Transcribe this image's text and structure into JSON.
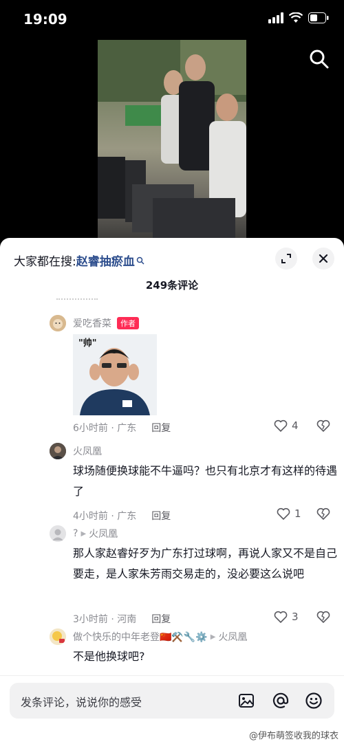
{
  "status": {
    "time": "19:09"
  },
  "icons": {
    "search": "search-icon",
    "signal": "signal-icon",
    "wifi": "wifi-icon",
    "battery": "battery-icon",
    "expand": "expand-icon",
    "close": "close-icon",
    "image": "image-icon",
    "mention": "at-icon",
    "emoji": "emoji-icon"
  },
  "header": {
    "hot_search_prefix": "大家都在搜:",
    "hot_search_term": "赵睿抽瘀血",
    "comment_count": "249条评论"
  },
  "comments": [
    {
      "user": "爱吃香菜",
      "badge": "作者",
      "sticker_text": "\"帅\"",
      "time": "6小时前 · 广东",
      "reply_label": "回复",
      "likes": "4"
    },
    {
      "user": "火凤凰",
      "text": "球场随便换球能不牛逼吗？也只有北京才有这样的待遇了",
      "time": "4小时前 · 广东",
      "reply_label": "回复",
      "likes": "1"
    },
    {
      "user": "?",
      "reply_to": "火凤凰",
      "text": "那人家赵睿好歹为广东打过球啊，再说人家又不是自己要走，是人家朱芳雨交易走的，没必要这么说吧",
      "time": "3小时前 · 河南",
      "reply_label": "回复",
      "likes": "3"
    },
    {
      "user": "做个快乐的中年老登🇨🇳⚒️🔧⚙️",
      "reply_to": "火凤凰",
      "text": "不是他换球吧?"
    }
  ],
  "input": {
    "placeholder": "发条评论，说说你的感受"
  },
  "watermark": "@伊布萌签收我的球衣",
  "colors": {
    "accent": "#fe2c55",
    "link": "#2B4C8C"
  }
}
